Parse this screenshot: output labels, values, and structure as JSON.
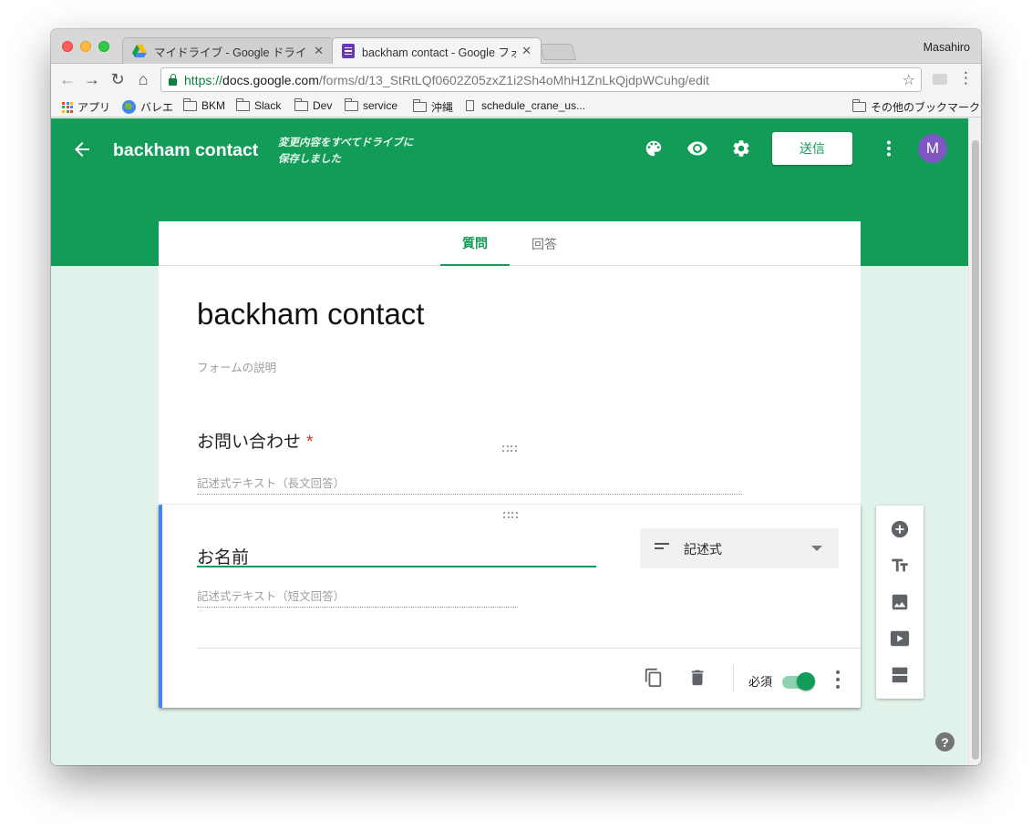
{
  "browser": {
    "tabs": [
      {
        "title": "マイドライブ - Google ドライブ",
        "close": "✕"
      },
      {
        "title": "backham contact - Google フォーム",
        "close": "✕"
      }
    ],
    "profile_name": "Masahiro",
    "url": {
      "scheme": "https://",
      "host": "docs.google.com",
      "path": "/forms/d/13_StRtLQf0602Z05zxZ1i2Sh4oMhH1ZnLkQjdpWCuhg/edit"
    },
    "nav": {
      "back": "←",
      "forward": "→",
      "reload": "↻",
      "home": "⌂",
      "star": "☆",
      "menu": "⋮"
    },
    "bookmarks": [
      {
        "label": "アプリ",
        "icon": "apps-grid-icon"
      },
      {
        "label": "バレエ",
        "icon": "globe-icon"
      },
      {
        "label": "BKM",
        "icon": "folder-icon"
      },
      {
        "label": "Slack",
        "icon": "folder-icon"
      },
      {
        "label": "Dev",
        "icon": "folder-icon"
      },
      {
        "label": "service",
        "icon": "folder-icon"
      },
      {
        "label": "沖縄",
        "icon": "folder-icon"
      },
      {
        "label": "schedule_crane_us...",
        "icon": "page-icon"
      }
    ],
    "other_bookmarks": "その他のブックマーク"
  },
  "forms_header": {
    "form_name": "backham contact",
    "save_status_line1": "変更内容をすべてドライブに",
    "save_status_line2": "保存しました",
    "send_label": "送信",
    "avatar_letter": "M",
    "icons": [
      "palette-icon",
      "preview-eye-icon",
      "settings-gear-icon",
      "more-vert-icon"
    ]
  },
  "form_tabs": {
    "questions": "質問",
    "responses": "回答"
  },
  "form": {
    "title": "backham contact",
    "description_placeholder": "フォームの説明",
    "questions": [
      {
        "label": "お問い合わせ",
        "required_mark": "*",
        "answer_placeholder": "記述式テキスト（長文回答）"
      }
    ],
    "active_question": {
      "title": "お名前",
      "type_label": "記述式",
      "answer_placeholder": "記述式テキスト（短文回答）",
      "required_label": "必須",
      "required_on": true
    }
  },
  "side_toolbar": [
    "add-question-icon",
    "add-title-icon",
    "add-image-icon",
    "add-video-icon",
    "add-section-icon"
  ],
  "help_label": "?",
  "colors": {
    "brand_green": "#129c58",
    "page_background": "#e0f2e9",
    "active_card_accent": "#4285f4",
    "avatar": "#7e57c2",
    "required_star": "#d93025"
  }
}
